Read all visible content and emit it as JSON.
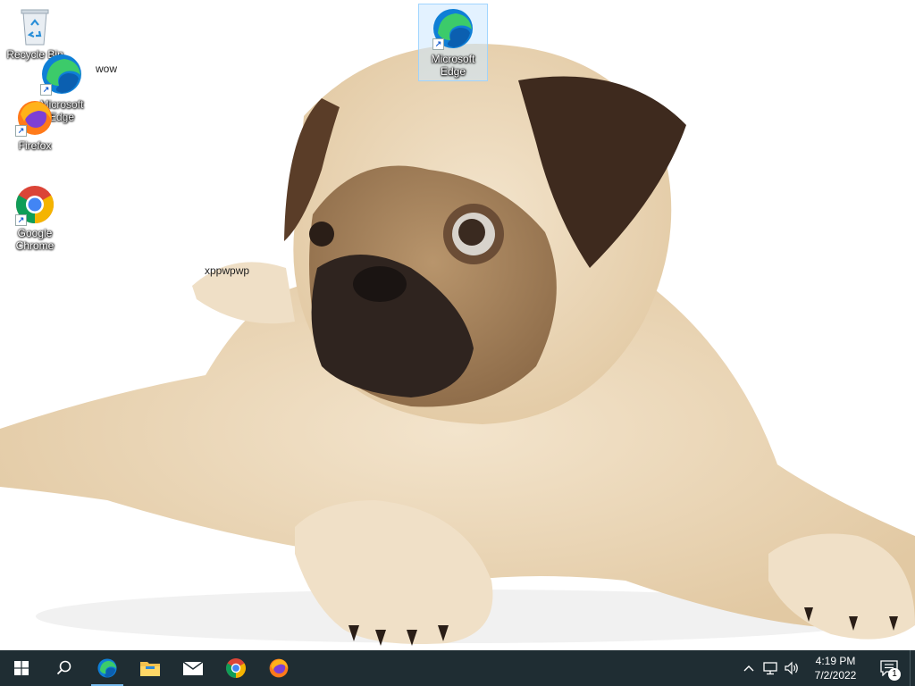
{
  "desktop": {
    "icons": [
      {
        "label": "Recycle Bin",
        "icon": "recycle-bin-icon"
      },
      {
        "label": "Microsoft Edge",
        "icon": "edge-icon"
      },
      {
        "label": "Firefox",
        "icon": "firefox-icon"
      },
      {
        "label": "Google Chrome",
        "icon": "chrome-icon"
      },
      {
        "label": "Microsoft Edge",
        "icon": "edge-icon",
        "selected": true
      }
    ],
    "floating_texts": [
      "wow",
      "xppwpwp"
    ]
  },
  "taskbar": {
    "pinned": [
      {
        "name": "start",
        "icon": "windows-logo-icon"
      },
      {
        "name": "search",
        "icon": "search-icon"
      },
      {
        "name": "edge",
        "icon": "edge-icon",
        "active": true
      },
      {
        "name": "file-explorer",
        "icon": "folder-icon"
      },
      {
        "name": "mail",
        "icon": "mail-icon"
      },
      {
        "name": "chrome",
        "icon": "chrome-icon"
      },
      {
        "name": "firefox",
        "icon": "firefox-icon"
      }
    ],
    "tray": {
      "icons": [
        "chevron-up-icon",
        "network-icon",
        "volume-icon"
      ],
      "time": "4:19 PM",
      "date": "7/2/2022",
      "notification_count": "1"
    }
  }
}
